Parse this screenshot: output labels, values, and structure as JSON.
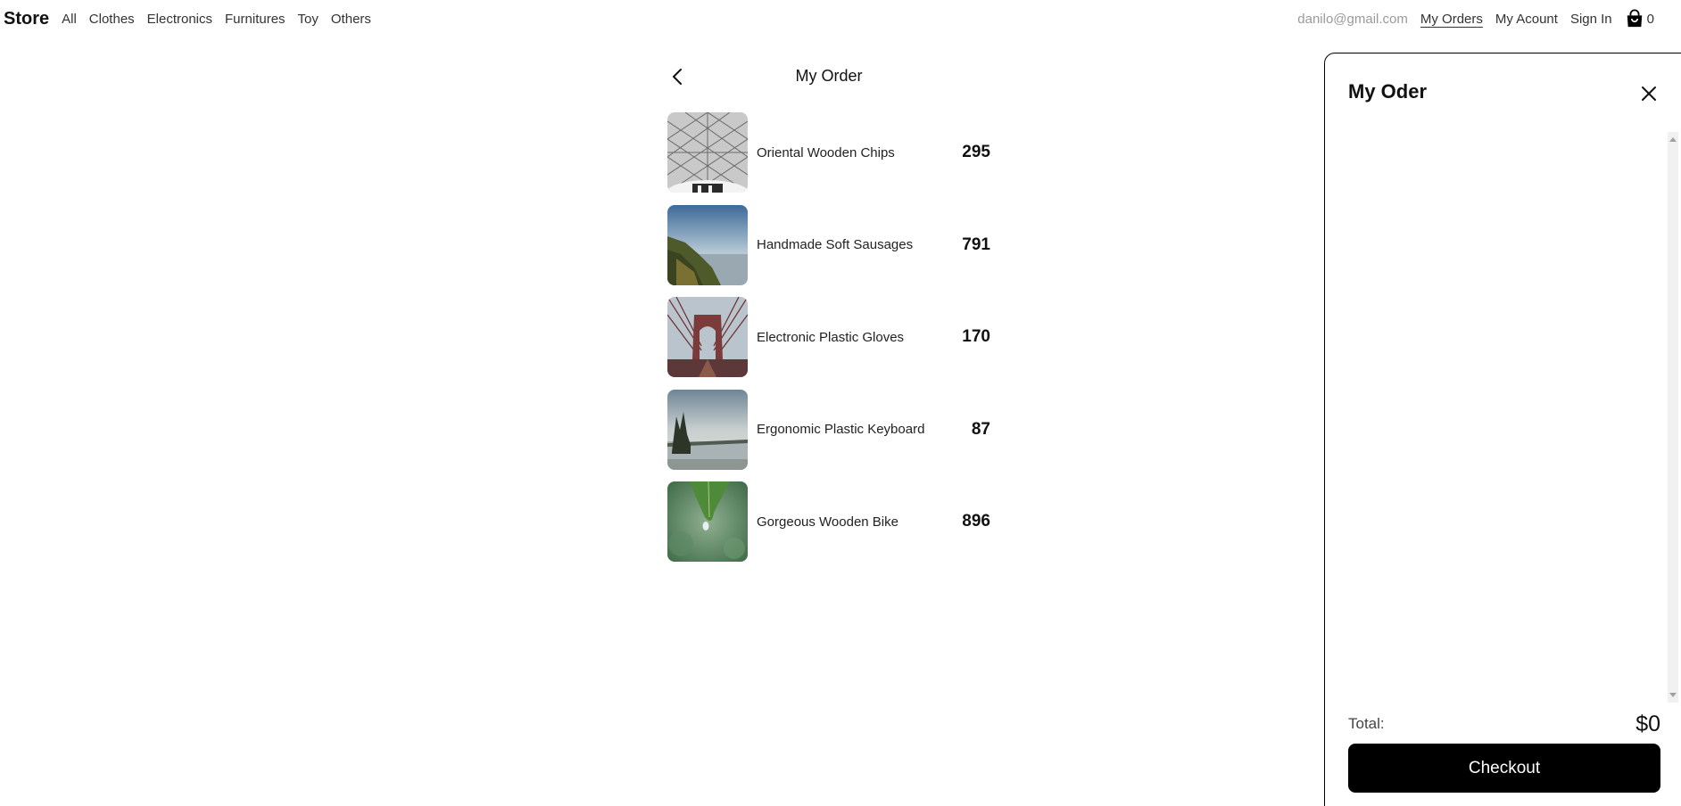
{
  "nav": {
    "brand": "Store",
    "categories": [
      "All",
      "Clothes",
      "Electronics",
      "Furnitures",
      "Toy",
      "Others"
    ],
    "email": "danilo@gmail.com",
    "my_orders": "My Orders",
    "my_account": "My Acount",
    "sign_in": "Sign In",
    "cart_count": "0",
    "cart_icon": "shopping-bag-icon"
  },
  "order": {
    "title": "My Order",
    "back_icon": "chevron-left-icon",
    "items": [
      {
        "name": "Oriental Wooden Chips",
        "price": "295"
      },
      {
        "name": "Handmade Soft Sausages",
        "price": "791"
      },
      {
        "name": "Electronic Plastic Gloves",
        "price": "170"
      },
      {
        "name": "Ergonomic Plastic Keyboard",
        "price": "87"
      },
      {
        "name": "Gorgeous Wooden Bike",
        "price": "896"
      }
    ]
  },
  "panel": {
    "title": "My Oder",
    "close_icon": "close-icon",
    "total_label": "Total:",
    "total_value": "$0",
    "checkout_label": "Checkout"
  },
  "colors": {
    "primary": "#000000",
    "muted": "#9a9a9a",
    "background": "#ffffff"
  }
}
